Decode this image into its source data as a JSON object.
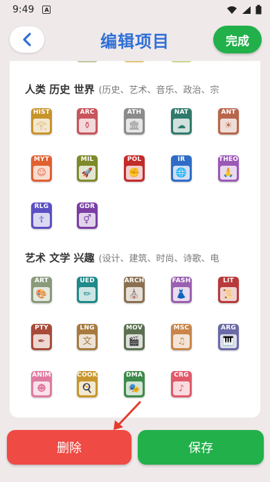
{
  "status": {
    "time": "9:49",
    "notification_letter": "A"
  },
  "header": {
    "title": "编辑项目",
    "done_label": "完成"
  },
  "sections": [
    {
      "title": "人类 历史 世界",
      "subtitle": "(历史、艺术、音乐、政治、宗",
      "items": [
        {
          "label": "HIST",
          "color": "#c8932a",
          "pic": "𓂀"
        },
        {
          "label": "ARC",
          "color": "#c9555c",
          "pic": "⚱"
        },
        {
          "label": "ATH",
          "color": "#8b8b8b",
          "pic": "🏛"
        },
        {
          "label": "NAT",
          "color": "#2f7a6b",
          "pic": "☁"
        },
        {
          "label": "ANT",
          "color": "#b8664b",
          "pic": "☀"
        },
        {
          "label": "MYT",
          "color": "#e06030",
          "pic": "☺"
        },
        {
          "label": "MIL",
          "color": "#7e8a2a",
          "pic": "🚀"
        },
        {
          "label": "POL",
          "color": "#c42b2b",
          "pic": "✊"
        },
        {
          "label": "IR",
          "color": "#2e6cc8",
          "pic": "🌐"
        },
        {
          "label": "THEO",
          "color": "#9b59b6",
          "pic": "🙏"
        },
        {
          "label": "RLG",
          "color": "#5b4fc4",
          "pic": "☦"
        },
        {
          "label": "GDR",
          "color": "#7a3ea6",
          "pic": "⚥"
        }
      ]
    },
    {
      "title": "艺术 文学 兴趣",
      "subtitle": "(设计、建筑、时尚、诗歌、电",
      "items": [
        {
          "label": "ART",
          "color": "#8a9a7a",
          "pic": "🎨"
        },
        {
          "label": "UED",
          "color": "#1f8a8a",
          "pic": "✏"
        },
        {
          "label": "ARCH",
          "color": "#8a7050",
          "pic": "⛪"
        },
        {
          "label": "FASH",
          "color": "#9a5fb0",
          "pic": "👗"
        },
        {
          "label": "LIT",
          "color": "#b83a3a",
          "pic": "📜"
        },
        {
          "label": "PTY",
          "color": "#a84a3a",
          "pic": "✒"
        },
        {
          "label": "LNG",
          "color": "#a87a40",
          "pic": "文"
        },
        {
          "label": "MOV",
          "color": "#5a7050",
          "pic": "🎬"
        },
        {
          "label": "MSC",
          "color": "#c9854a",
          "pic": "♫"
        },
        {
          "label": "ARG",
          "color": "#6a6aa8",
          "pic": "🎹"
        },
        {
          "label": "ANIM",
          "color": "#e07aa0",
          "pic": "☻"
        },
        {
          "label": "COOK",
          "color": "#c8962a",
          "pic": "🍳"
        },
        {
          "label": "DMA",
          "color": "#3e8a4a",
          "pic": "🎭"
        },
        {
          "label": "CRG",
          "color": "#e05a6a",
          "pic": "♪"
        }
      ]
    }
  ],
  "footer": {
    "delete_label": "删除",
    "save_label": "保存"
  },
  "colors": {
    "accent_blue": "#2f6fd6",
    "green": "#22b04a",
    "red": "#ef4a43"
  }
}
